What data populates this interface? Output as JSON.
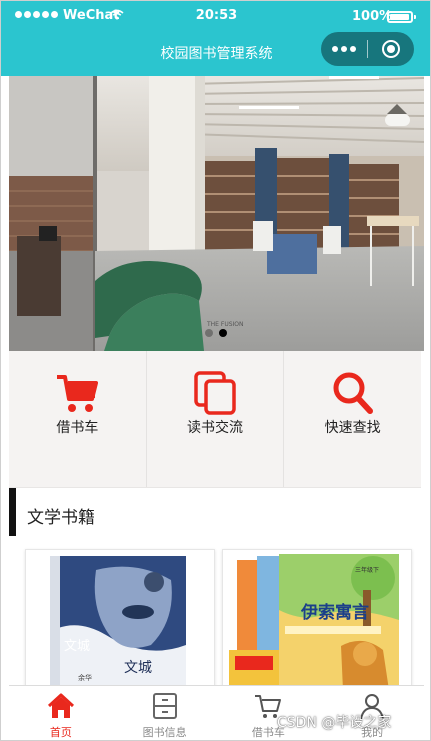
{
  "status_bar": {
    "carrier": "WeChat",
    "time": "20:53",
    "battery": "100%",
    "wifi_icon": "wifi-icon",
    "battery_level": 1.0
  },
  "nav": {
    "title": "校园图书管理系统",
    "more_icon": "more-dots-icon",
    "close_icon": "target-close-icon"
  },
  "banner": {
    "slide_count": 2,
    "active_slide": 2,
    "photo_text": "THE FUSION"
  },
  "menu": [
    {
      "label": "借书车",
      "icon": "cart-icon"
    },
    {
      "label": "读书交流",
      "icon": "copy-icon"
    },
    {
      "label": "快速查找",
      "icon": "search-icon"
    }
  ],
  "section": {
    "title": "文学书籍"
  },
  "books": [
    {
      "cover_title": "文城",
      "cover_author": "余华"
    },
    {
      "cover_title": "伊索寓言",
      "cover_badge": "三年级下"
    }
  ],
  "tabs": [
    {
      "label": "首页",
      "icon": "home-icon",
      "active": true
    },
    {
      "label": "图书信息",
      "icon": "cabinet-icon",
      "active": false
    },
    {
      "label": "借书车",
      "icon": "cart-icon",
      "active": false
    },
    {
      "label": "我的",
      "icon": "user-icon",
      "active": false
    }
  ],
  "watermark": "CSDN @毕设之家",
  "colors": {
    "nav_bg": "#2bc5cf",
    "capsule_bg": "#17767d",
    "accent_red": "#e9281d",
    "tab_inactive": "#8a8a8a",
    "menu_bg": "#f5f3f2"
  }
}
